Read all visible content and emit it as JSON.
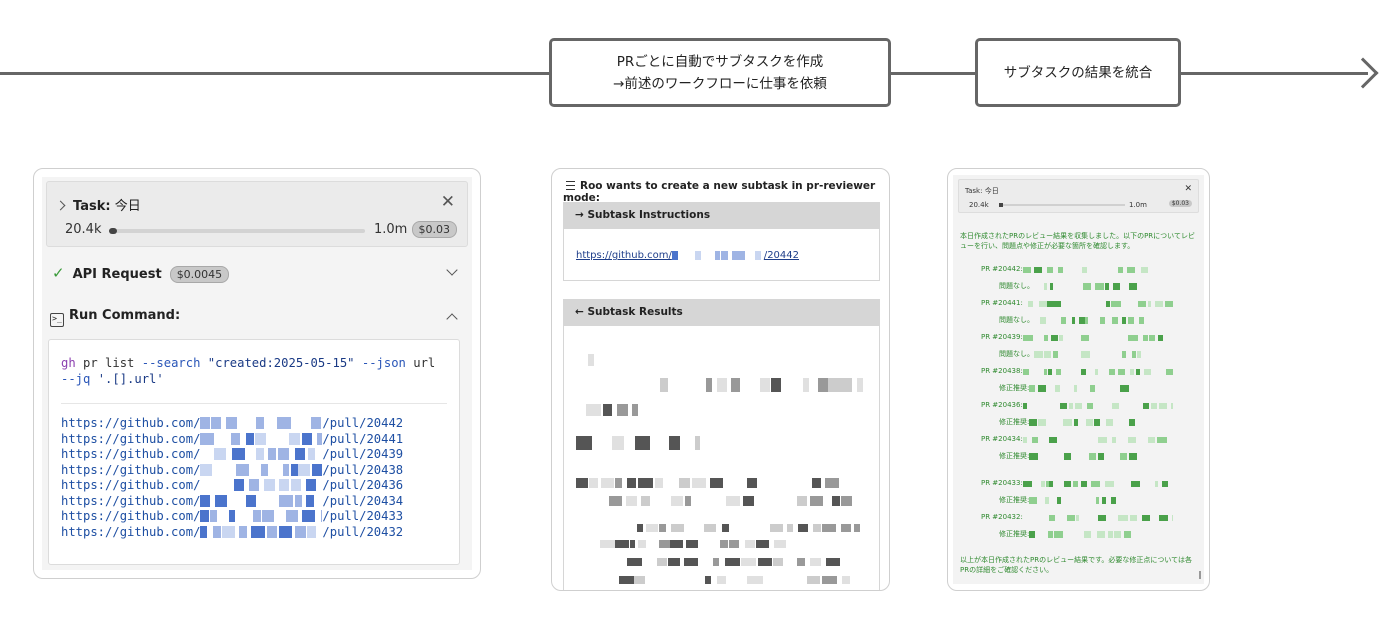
{
  "flow": {
    "step1": {
      "line1": "PRごとに自動でサブタスクを作成",
      "line2": "→前述のワークフローに仕事を依頼"
    },
    "step2": {
      "label": "サブタスクの結果を統合"
    }
  },
  "panel1": {
    "task": {
      "label": "Task:",
      "name": "今日",
      "tokens_low": "20.4k",
      "tokens_high": "1.0m",
      "cost": "$0.03",
      "progress_fraction": 0.02,
      "close_icon": "close-icon",
      "expand_icon": "chevron-right-icon"
    },
    "api_request": {
      "label": "API Request",
      "cost": "$0.0045",
      "status_icon": "check-icon"
    },
    "run_command": {
      "label": "Run Command:",
      "icon": "terminal-icon"
    },
    "command": {
      "kw": "gh",
      "rest": " pr list ",
      "flag1": "--search",
      "arg1": " \"created:2025-05-15\" ",
      "flag2": "--json",
      "arg2": " url",
      "flag3": "--jq",
      "arg3": " '.[].url'"
    },
    "urls": [
      {
        "prefix": "https://github.com/",
        "suffix": "/pull/20442"
      },
      {
        "prefix": "https://github.com/",
        "suffix": "/pull/20441"
      },
      {
        "prefix": "https://github.com/",
        "suffix": "/pull/20439"
      },
      {
        "prefix": "https://github.com/",
        "suffix": "/pull/20438"
      },
      {
        "prefix": "https://github.com/",
        "suffix": "/pull/20436"
      },
      {
        "prefix": "https://github.com/",
        "suffix": "/pull/20434"
      },
      {
        "prefix": "https://github.com/",
        "suffix": "/pull/20433"
      },
      {
        "prefix": "https://github.com/",
        "suffix": "/pull/20432"
      }
    ]
  },
  "panel2": {
    "header": "Roo wants to create a new subtask in pr-reviewer mode:",
    "instructions_label": "→ Subtask Instructions",
    "link_prefix": "https://github.com/",
    "link_suffix": "/20442",
    "results_label": "← Subtask Results"
  },
  "panel3": {
    "task_label": "Task: 今日",
    "tokens_low": "20.4k",
    "tokens_high": "1.0m",
    "cost": "$0.03",
    "intro": "本日作成されたPRのレビュー結果を収集しました。以下のPRについてレビューを行い、問題点や修正が必要な箇所を確認します。",
    "items": [
      {
        "pr": "PR #20442:",
        "status": "問題なし。"
      },
      {
        "pr": "PR #20441:",
        "status": "問題なし。"
      },
      {
        "pr": "PR #20439:",
        "status": "問題なし。"
      },
      {
        "pr": "PR #20438:",
        "status": "修正推奨:"
      },
      {
        "pr": "PR #20436:",
        "status": "修正推奨:"
      },
      {
        "pr": "PR #20434:",
        "status": "修正推奨:"
      },
      {
        "pr": "PR #20433:",
        "status": "修正推奨:"
      },
      {
        "pr": "PR #20432:",
        "status": "修正推奨:"
      }
    ],
    "outro": "以上が本日作成されたPRのレビュー結果です。必要な修正点については各PRの詳細をご確認ください。"
  },
  "colors": {
    "link": "#1e4fa3",
    "keyword": "#8b3fb0",
    "result_text": "#2f8a2f",
    "check": "#3b9b3b",
    "flow_line": "#666666"
  }
}
